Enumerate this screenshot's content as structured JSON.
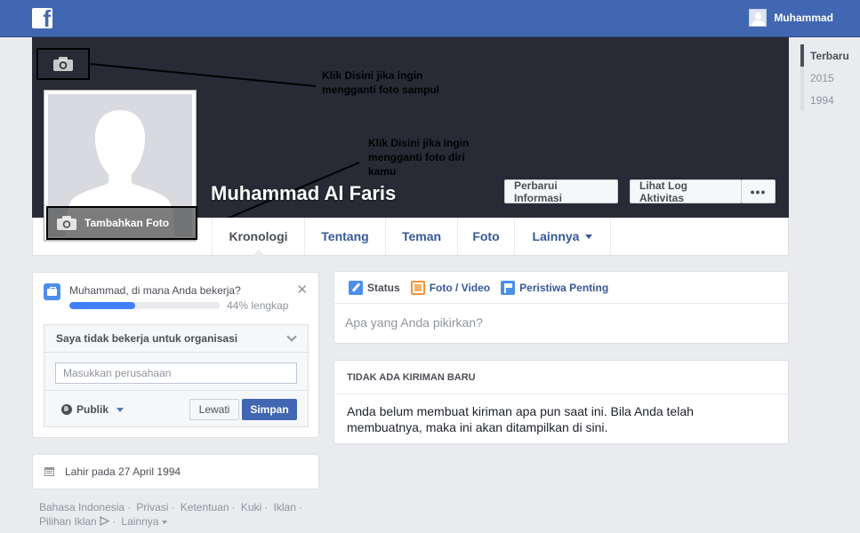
{
  "topbar": {
    "logo_glyph": "f",
    "user_name": "Muhammad"
  },
  "profile": {
    "name": "Muhammad Al Faris",
    "add_photo_label": "Tambahkan Foto"
  },
  "annotations": {
    "cover": "Klik Disini jika ingin mengganti foto sampul",
    "profile_pic": "Klik Disini jika ingin mengganti foto diri kamu"
  },
  "cover_buttons": {
    "update_info": "Perbarui Informasi",
    "activity_log": "Lihat Log Aktivitas",
    "more": "•••"
  },
  "nav": {
    "tabs": [
      {
        "label": "Kronologi"
      },
      {
        "label": "Tentang"
      },
      {
        "label": "Teman"
      },
      {
        "label": "Foto"
      },
      {
        "label": "Lainnya"
      }
    ]
  },
  "years": [
    "Terbaru",
    "2015",
    "1994"
  ],
  "work_card": {
    "question": "Muhammad, di mana Anda bekerja?",
    "progress_percent": 44,
    "progress_text": "44% lengkap",
    "close_glyph": "✕",
    "toggle_label": "Saya tidak bekerja untuk organisasi",
    "company_placeholder": "Masukkan perusahaan",
    "privacy_label": "Publik",
    "skip_label": "Lewati",
    "save_label": "Simpan"
  },
  "birthday": {
    "text": "Lahir pada 27 April 1994"
  },
  "footer": {
    "links": [
      "Bahasa Indonesia",
      "Privasi",
      "Ketentuan",
      "Kuki",
      "Iklan",
      "Pilihan Iklan",
      "Lainnya"
    ]
  },
  "composer": {
    "tabs": [
      {
        "label": "Status"
      },
      {
        "label": "Foto / Video"
      },
      {
        "label": "Peristiwa Penting"
      }
    ],
    "placeholder": "Apa yang Anda pikirkan?"
  },
  "no_posts": {
    "header": "TIDAK ADA KIRIMAN BARU",
    "body": "Anda belum membuat kiriman apa pun saat ini. Bila Anda telah membuatnya, maka ini akan ditampilkan di sini."
  },
  "colors": {
    "brand_blue": "#4267b2",
    "cover_bg": "#282b36",
    "progress": "#4080ff"
  }
}
